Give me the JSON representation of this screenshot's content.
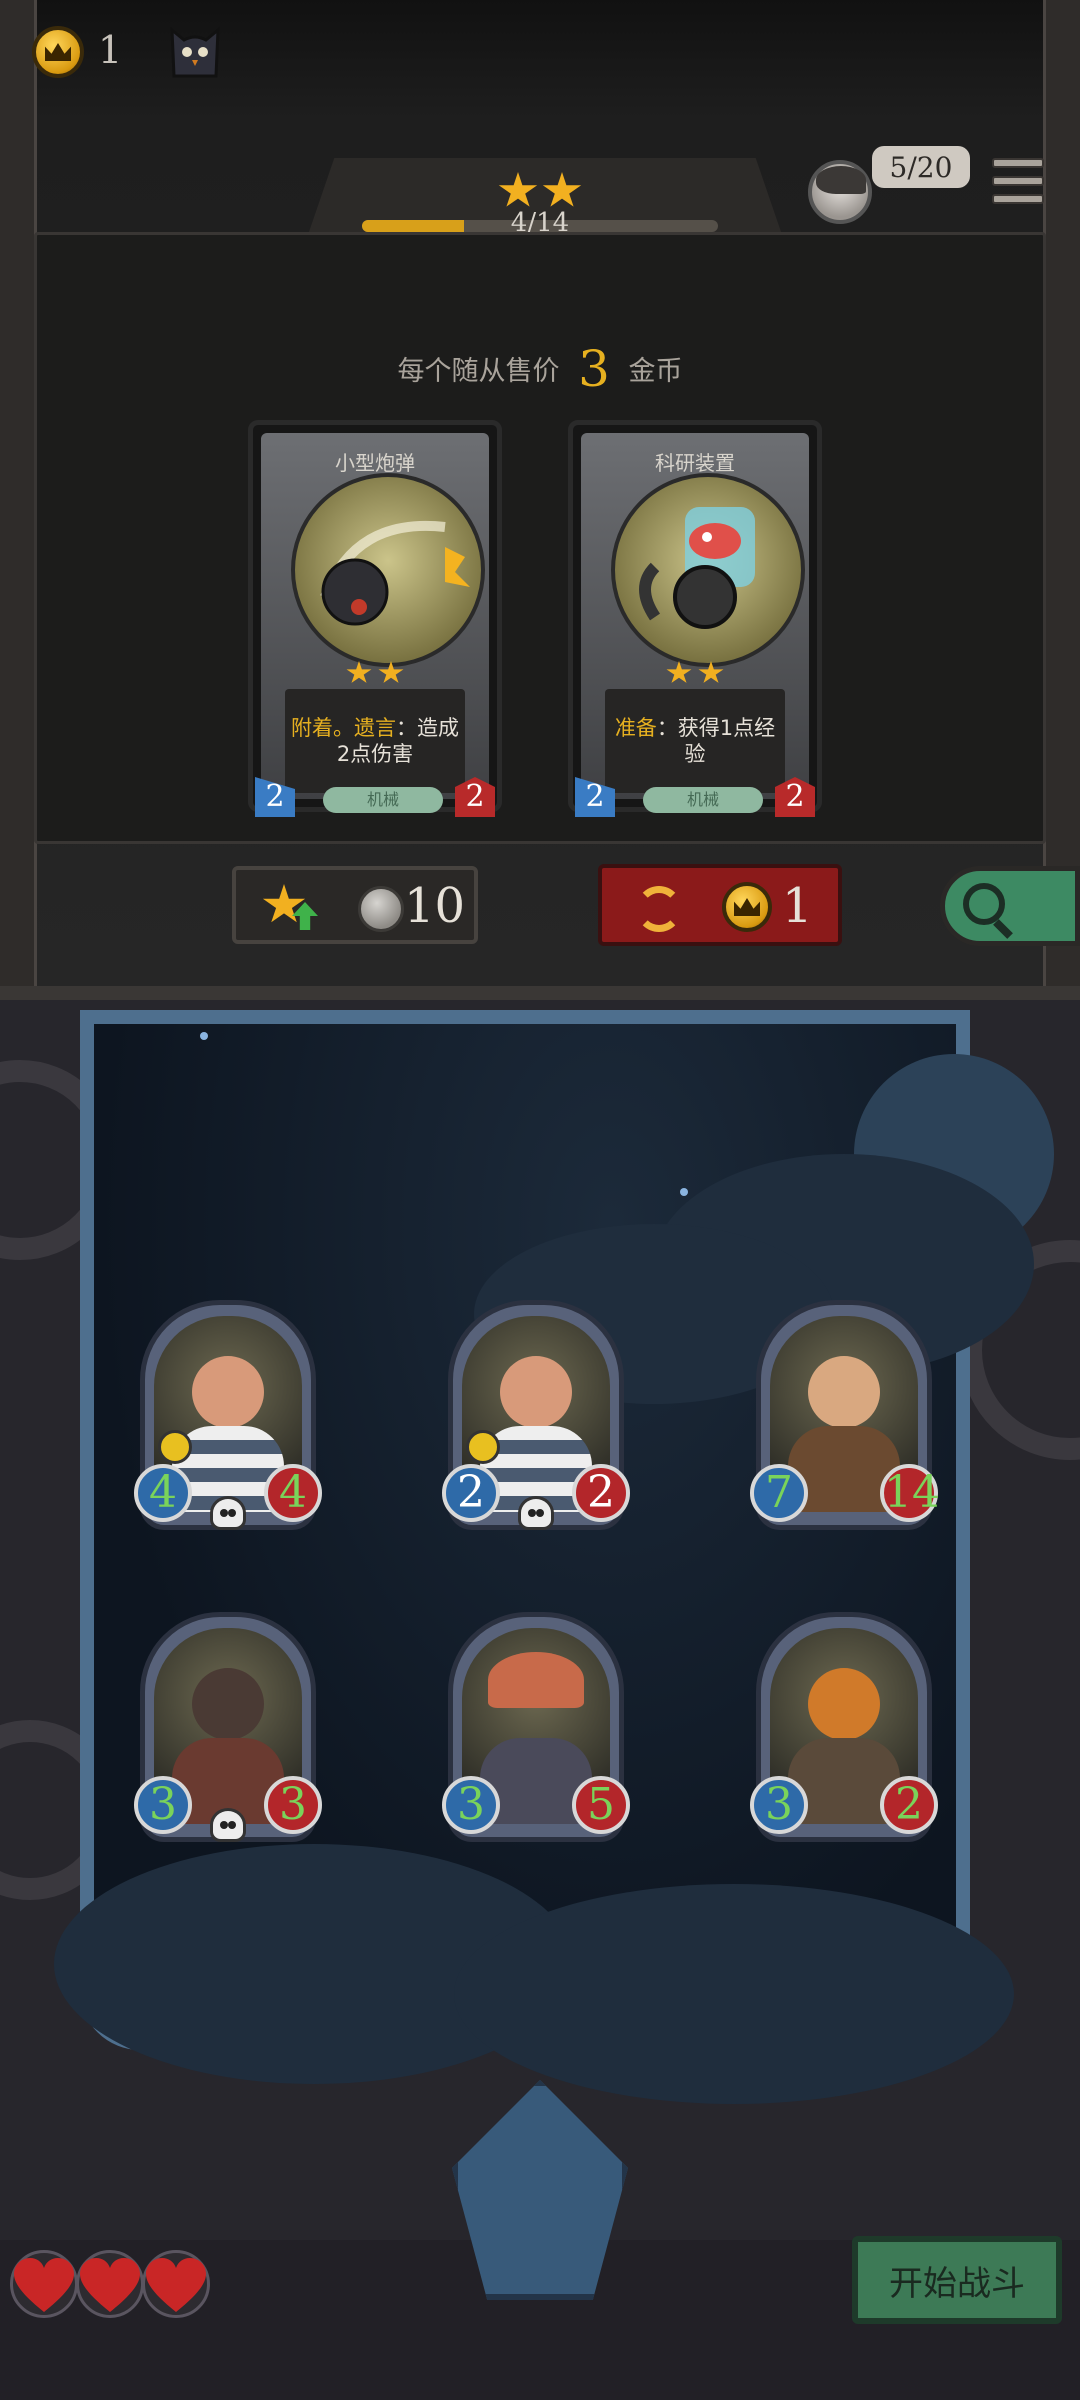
{
  "topbar": {
    "gold": "1",
    "xp_text": "4/14",
    "xp_progress": 0.2857,
    "tier_stars": 2,
    "turn_badge": "5/20"
  },
  "shop": {
    "price_prefix": "每个随从售价",
    "price_value": "3",
    "price_suffix": "金币",
    "cards": [
      {
        "name": "小型炮弹",
        "stars": 2,
        "desc_keyword": "附着。遗言",
        "desc_rest": "：造成2点伤害",
        "tag": "机械",
        "attack": "2",
        "health": "2"
      },
      {
        "name": "科研装置",
        "stars": 2,
        "desc_keyword": "准备",
        "desc_rest": "：获得1点经验",
        "tag": "机械",
        "attack": "2",
        "health": "2"
      }
    ],
    "upgrade_cost": "10",
    "refresh_cost": "1"
  },
  "board": {
    "minions": [
      {
        "attack": "4",
        "health": "4"
      },
      {
        "attack": "2",
        "health": "2"
      },
      {
        "attack": "7",
        "health": "14"
      },
      {
        "attack": "3",
        "health": "3"
      },
      {
        "attack": "3",
        "health": "5"
      },
      {
        "attack": "3",
        "health": "2"
      }
    ]
  },
  "footer": {
    "lives": 3,
    "start_label": "开始战斗"
  },
  "colors": {
    "gold": "#e6b020",
    "health_red": "#b3262a",
    "attack_blue": "#2e6aa8",
    "start_green": "#3d7a56"
  }
}
